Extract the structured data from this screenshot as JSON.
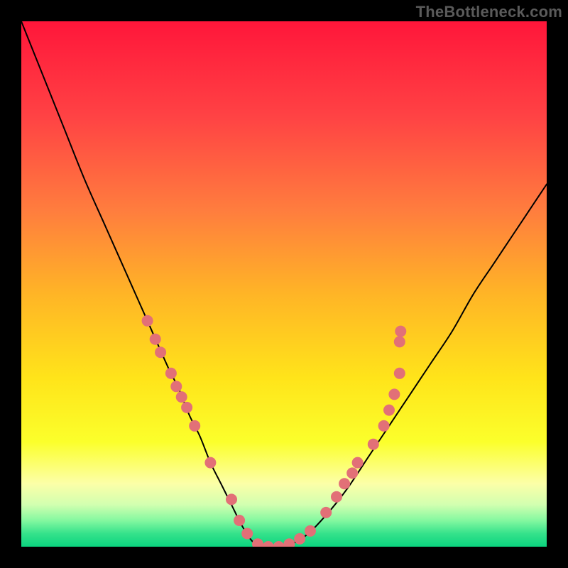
{
  "watermark": "TheBottleneck.com",
  "chart_data": {
    "type": "line",
    "title": "",
    "xlabel": "",
    "ylabel": "",
    "xlim": [
      0,
      100
    ],
    "ylim": [
      0,
      100
    ],
    "grid": false,
    "legend": false,
    "series": [
      {
        "name": "bottleneck-curve",
        "x": [
          0,
          4,
          8,
          12,
          16,
          20,
          24,
          28,
          30,
          32,
          34,
          36,
          38,
          40,
          42,
          44,
          46,
          50,
          54,
          58,
          62,
          66,
          70,
          74,
          78,
          82,
          86,
          90,
          94,
          98,
          100
        ],
        "y": [
          100,
          90,
          80,
          70,
          61,
          52,
          43,
          34,
          30,
          25,
          21,
          16,
          12,
          8,
          4,
          1,
          0,
          0,
          2,
          6,
          11,
          17,
          23,
          29,
          35,
          41,
          48,
          54,
          60,
          66,
          69
        ],
        "color": "#000000",
        "stroke_width": 2
      }
    ],
    "markers": [
      {
        "x": 24.0,
        "y": 43.0
      },
      {
        "x": 25.5,
        "y": 39.5
      },
      {
        "x": 26.5,
        "y": 37.0
      },
      {
        "x": 28.5,
        "y": 33.0
      },
      {
        "x": 29.5,
        "y": 30.5
      },
      {
        "x": 30.5,
        "y": 28.5
      },
      {
        "x": 31.5,
        "y": 26.5
      },
      {
        "x": 33.0,
        "y": 23.0
      },
      {
        "x": 36.0,
        "y": 16.0
      },
      {
        "x": 40.0,
        "y": 9.0
      },
      {
        "x": 41.5,
        "y": 5.0
      },
      {
        "x": 43.0,
        "y": 2.5
      },
      {
        "x": 45.0,
        "y": 0.5
      },
      {
        "x": 47.0,
        "y": 0.0
      },
      {
        "x": 49.0,
        "y": 0.0
      },
      {
        "x": 51.0,
        "y": 0.5
      },
      {
        "x": 53.0,
        "y": 1.5
      },
      {
        "x": 55.0,
        "y": 3.0
      },
      {
        "x": 58.0,
        "y": 6.5
      },
      {
        "x": 60.0,
        "y": 9.5
      },
      {
        "x": 61.5,
        "y": 12.0
      },
      {
        "x": 63.0,
        "y": 14.0
      },
      {
        "x": 64.0,
        "y": 16.0
      },
      {
        "x": 67.0,
        "y": 19.5
      },
      {
        "x": 69.0,
        "y": 23.0
      },
      {
        "x": 70.0,
        "y": 26.0
      },
      {
        "x": 71.0,
        "y": 29.0
      },
      {
        "x": 72.0,
        "y": 33.0
      },
      {
        "x": 72.0,
        "y": 39.0
      },
      {
        "x": 72.2,
        "y": 41.0
      }
    ],
    "marker_style": {
      "fill": "#e27077",
      "radius_px": 8
    },
    "background_gradient": {
      "type": "vertical",
      "stops": [
        {
          "pos": 0.0,
          "color": "#ff163a"
        },
        {
          "pos": 0.18,
          "color": "#ff4244"
        },
        {
          "pos": 0.36,
          "color": "#ff7d3e"
        },
        {
          "pos": 0.52,
          "color": "#ffb526"
        },
        {
          "pos": 0.68,
          "color": "#ffe41a"
        },
        {
          "pos": 0.8,
          "color": "#fbff2b"
        },
        {
          "pos": 0.88,
          "color": "#fcffa8"
        },
        {
          "pos": 0.92,
          "color": "#d2ffb0"
        },
        {
          "pos": 0.95,
          "color": "#84f8a0"
        },
        {
          "pos": 0.975,
          "color": "#35e28b"
        },
        {
          "pos": 1.0,
          "color": "#0bd47f"
        }
      ]
    }
  }
}
